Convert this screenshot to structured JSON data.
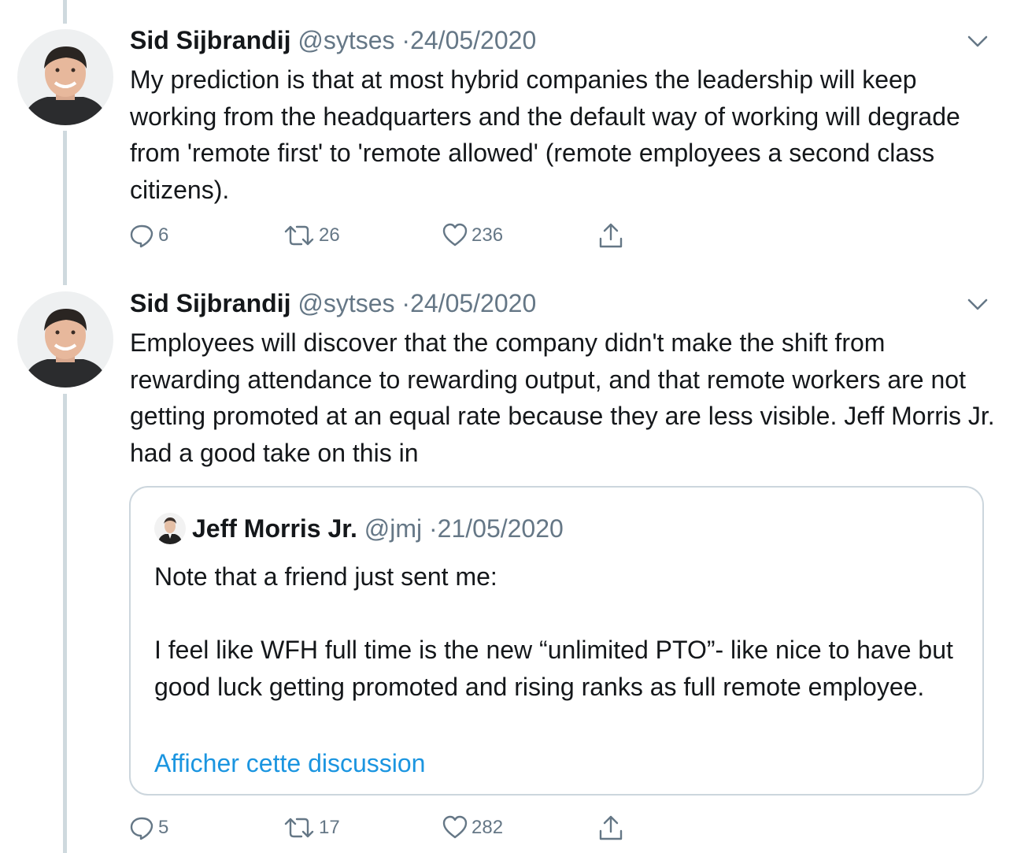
{
  "tweets": [
    {
      "author": "Sid Sijbrandij",
      "handle": "@sytses",
      "separator": "·",
      "date": "24/05/2020",
      "text": "My prediction is that at most hybrid companies the leadership will keep working from the headquarters and the default way of working will degrade from 'remote first' to 'remote allowed' (remote employees a second class citizens).",
      "replies": "6",
      "retweets": "26",
      "likes": "236"
    },
    {
      "author": "Sid Sijbrandij",
      "handle": "@sytses",
      "separator": "·",
      "date": "24/05/2020",
      "text": "Employees will discover that the company didn't make the shift from rewarding attendance to rewarding output, and that remote workers are not getting promoted at an equal rate because they are less visible. Jeff Morris Jr. had a good take on this in",
      "replies": "5",
      "retweets": "17",
      "likes": "282",
      "quote": {
        "author": "Jeff Morris Jr.",
        "handle": "@jmj",
        "separator": "·",
        "date": "21/05/2020",
        "line1": "Note that a friend just sent me:",
        "line2": "I feel like WFH full time is the new “unlimited PTO”- like nice to have but good luck getting promoted and rising ranks as full remote employee.",
        "link": "Afficher cette discussion"
      }
    }
  ],
  "icons": [
    "reply-icon",
    "retweet-icon",
    "like-icon",
    "share-icon",
    "chevron-down-icon"
  ],
  "colors": {
    "text": "#14171a",
    "muted": "#657786",
    "link": "#1b95e0",
    "thread": "#cfd9de",
    "border": "#ccd6dd"
  }
}
